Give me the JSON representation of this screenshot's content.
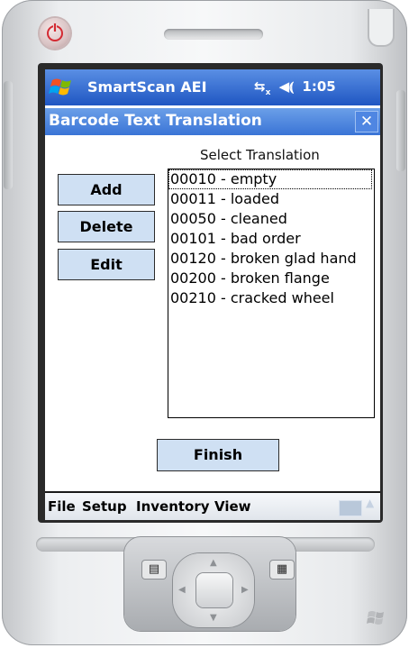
{
  "statusbar": {
    "app_title": "SmartScan AEI",
    "time": "1:05",
    "connectivity_icon": "connectivity-icon",
    "volume_icon": "volume-icon"
  },
  "window": {
    "title": "Barcode Text Translation",
    "close_label": "✕"
  },
  "buttons": {
    "add": "Add",
    "delete": "Delete",
    "edit": "Edit",
    "finish": "Finish"
  },
  "translation": {
    "label": "Select Translation",
    "items": [
      "00010 - empty",
      "00011 - loaded",
      "00050 - cleaned",
      "00101 - bad order",
      "00120 - broken glad hand",
      "00200 - broken flange",
      "00210 - cracked wheel"
    ],
    "selected_index": 0
  },
  "menubar": {
    "items": [
      "File",
      "Setup",
      "Inventory",
      "View"
    ]
  },
  "colors": {
    "statusbar": "#1f56c2",
    "titlebar": "#3a74d6",
    "button_face": "#cfe0f3"
  }
}
